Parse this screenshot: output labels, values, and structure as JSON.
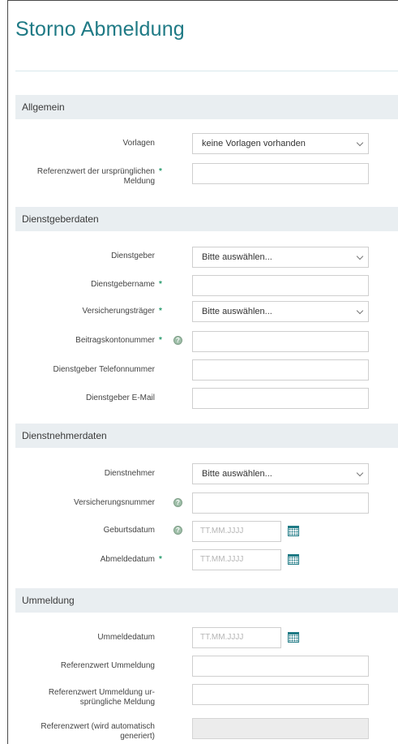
{
  "page": {
    "title": "Storno Abmeldung"
  },
  "sections": {
    "allgemein": {
      "title": "Allgemein",
      "vorlagen_label": "Vorlagen",
      "vorlagen_value": "keine Vorlagen vorhanden",
      "referenzwert_label_1": "Referenzwert der ursprünglichen",
      "referenzwert_label_2": "Meldung"
    },
    "dienstgeber": {
      "title": "Dienstgeberdaten",
      "dienstgeber_label": "Dienstgeber",
      "dienstgeber_value": "Bitte auswählen...",
      "dienstgebername_label": "Dienstgebername",
      "versicherungstraeger_label": "Versicherungsträger",
      "versicherungstraeger_value": "Bitte auswählen...",
      "beitragskontonummer_label": "Beitragskontonummer",
      "telefon_label": "Dienstgeber Telefonnummer",
      "email_label": "Dienstgeber E-Mail"
    },
    "dienstnehmer": {
      "title": "Dienstnehmerdaten",
      "dienstnehmer_label": "Dienstnehmer",
      "dienstnehmer_value": "Bitte auswählen...",
      "versicherungsnummer_label": "Versicherungsnummer",
      "geburtsdatum_label": "Geburtsdatum",
      "geburtsdatum_placeholder": "TT.MM.JJJJ",
      "abmeldedatum_label": "Abmeldedatum",
      "abmeldedatum_placeholder": "TT.MM.JJJJ"
    },
    "ummeldung": {
      "title": "Ummeldung",
      "ummeldedatum_label": "Ummeldedatum",
      "ummeldedatum_placeholder": "TT.MM.JJJJ",
      "ref_ummeldung_label": "Referenzwert Ummeldung",
      "ref_urspr_label_1": "Referenzwert Ummeldung ur-",
      "ref_urspr_label_2": "sprüngliche Meldung",
      "ref_auto_label_1": "Referenzwert (wird automatisch",
      "ref_auto_label_2": "generiert)"
    }
  },
  "common": {
    "required_mark": "*",
    "help_mark": "?"
  },
  "colors": {
    "title": "#1f7a85",
    "required": "#2a9d6f",
    "section_bg": "#e9eef1"
  },
  "icons": {
    "calendar": "calendar-icon",
    "help": "help-icon",
    "chevron": "chevron-down-icon"
  }
}
